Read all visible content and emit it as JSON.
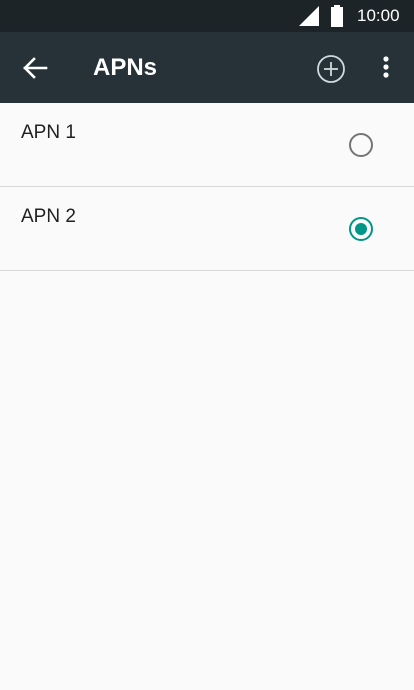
{
  "status_bar": {
    "time": "10:00",
    "icons": [
      "cell-signal-icon",
      "battery-icon"
    ]
  },
  "app_bar": {
    "title": "APNs",
    "icons": [
      "back-arrow-icon",
      "add-circle-icon",
      "more-vert-icon"
    ]
  },
  "apn_list": {
    "items": [
      {
        "label": "APN 1",
        "selected": false
      },
      {
        "label": "APN 2",
        "selected": true
      }
    ]
  },
  "colors": {
    "status_bar_bg": "#1c2428",
    "app_bar_bg": "#263238",
    "radio_selected": "#009688",
    "radio_unselected": "#757575",
    "list_bg": "#fafafa"
  }
}
